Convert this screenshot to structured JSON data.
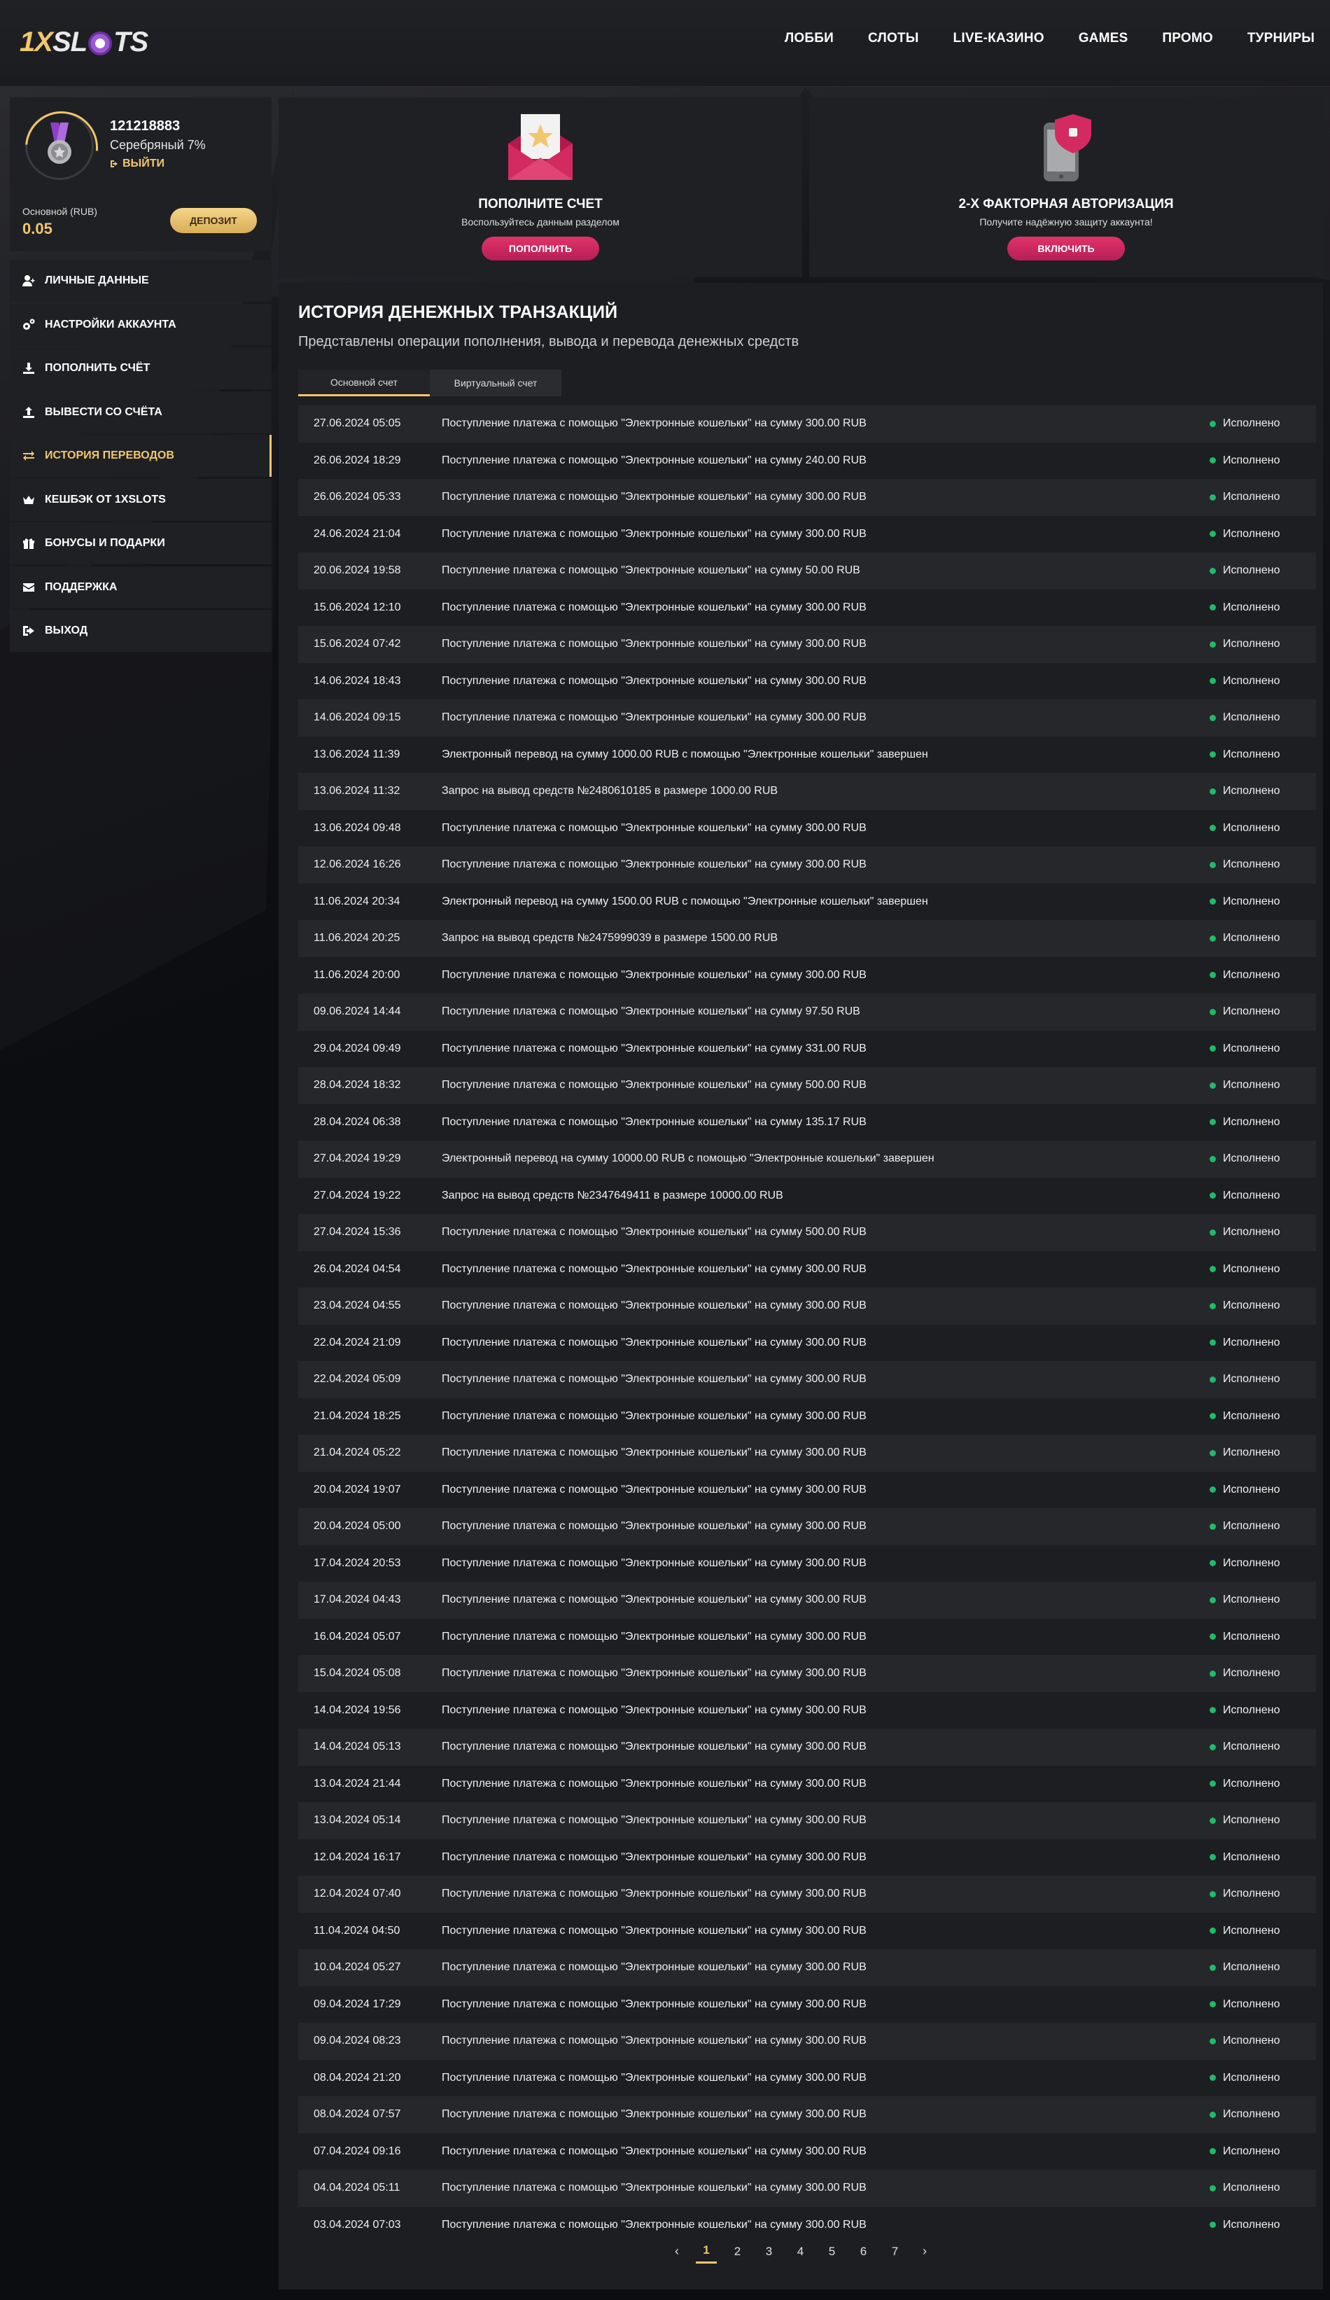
{
  "header": {
    "logo_part1": "1X",
    "logo_part2": "SL",
    "logo_part3": "TS",
    "nav": [
      "ЛОББИ",
      "СЛОТЫ",
      "LIVE-КАЗИНО",
      "GAMES",
      "ПРОМО",
      "ТУРНИРЫ"
    ]
  },
  "profile": {
    "user_id": "121218883",
    "level": "Серебряный 7%",
    "logout_link": "ВЫЙТИ",
    "balance_label": "Основной (RUB)",
    "balance_value": "0.05",
    "deposit_button": "ДЕПОЗИТ"
  },
  "menu": [
    {
      "label": "ЛИЧНЫЕ ДАННЫЕ",
      "icon": "user-plus-icon"
    },
    {
      "label": "НАСТРОЙКИ АККАУНТА",
      "icon": "gears-icon"
    },
    {
      "label": "ПОПОЛНИТЬ СЧЁТ",
      "icon": "download-icon"
    },
    {
      "label": "ВЫВЕСТИ СО СЧЁТА",
      "icon": "upload-icon"
    },
    {
      "label": "ИСТОРИЯ ПЕРЕВОДОВ",
      "icon": "exchange-icon",
      "active": true
    },
    {
      "label": "КЕШБЭК ОТ 1XSLOTS",
      "icon": "crown-icon"
    },
    {
      "label": "БОНУСЫ И ПОДАРКИ",
      "icon": "gift-icon"
    },
    {
      "label": "ПОДДЕРЖКА",
      "icon": "envelope-icon"
    },
    {
      "label": "ВЫХОД",
      "icon": "sign-out-icon"
    }
  ],
  "cards": {
    "deposit": {
      "title": "ПОПОЛНИТЕ СЧЕТ",
      "subtitle": "Воспользуйтесь данным разделом",
      "button": "ПОПОЛНИТЬ"
    },
    "twofa": {
      "title": "2-Х ФАКТОРНАЯ АВТОРИЗАЦИЯ",
      "subtitle": "Получите надёжную защиту аккаунта!",
      "button": "ВКЛЮЧИТЬ"
    }
  },
  "main": {
    "title": "ИСТОРИЯ ДЕНЕЖНЫХ ТРАНЗАКЦИЙ",
    "subtitle": "Представлены операции пополнения, вывода и перевода денежных средств",
    "tabs": [
      "Основной счет",
      "Виртуальный счет"
    ]
  },
  "colors": {
    "accent": "#f1c76d",
    "pink": "#d42a62",
    "status_ok": "#1fba6a"
  },
  "transactions": [
    {
      "date": "27.06.2024 05:05",
      "desc": "Поступление платежа с помощью \"Электронные кошельки\" на сумму 300.00 RUB",
      "status": "Исполнено"
    },
    {
      "date": "26.06.2024 18:29",
      "desc": "Поступление платежа с помощью \"Электронные кошельки\" на сумму 240.00 RUB",
      "status": "Исполнено"
    },
    {
      "date": "26.06.2024 05:33",
      "desc": "Поступление платежа с помощью \"Электронные кошельки\" на сумму 300.00 RUB",
      "status": "Исполнено"
    },
    {
      "date": "24.06.2024 21:04",
      "desc": "Поступление платежа с помощью \"Электронные кошельки\" на сумму 300.00 RUB",
      "status": "Исполнено"
    },
    {
      "date": "20.06.2024 19:58",
      "desc": "Поступление платежа с помощью \"Электронные кошельки\" на сумму 50.00 RUB",
      "status": "Исполнено"
    },
    {
      "date": "15.06.2024 12:10",
      "desc": "Поступление платежа с помощью \"Электронные кошельки\" на сумму 300.00 RUB",
      "status": "Исполнено"
    },
    {
      "date": "15.06.2024 07:42",
      "desc": "Поступление платежа с помощью \"Электронные кошельки\" на сумму 300.00 RUB",
      "status": "Исполнено"
    },
    {
      "date": "14.06.2024 18:43",
      "desc": "Поступление платежа с помощью \"Электронные кошельки\" на сумму 300.00 RUB",
      "status": "Исполнено"
    },
    {
      "date": "14.06.2024 09:15",
      "desc": "Поступление платежа с помощью \"Электронные кошельки\" на сумму 300.00 RUB",
      "status": "Исполнено"
    },
    {
      "date": "13.06.2024 11:39",
      "desc": "Электронный перевод на сумму 1000.00 RUB с помощью \"Электронные кошельки\" завершен",
      "status": "Исполнено"
    },
    {
      "date": "13.06.2024 11:32",
      "desc": "Запрос на вывод средств №2480610185 в размере 1000.00 RUB",
      "status": "Исполнено"
    },
    {
      "date": "13.06.2024 09:48",
      "desc": "Поступление платежа с помощью \"Электронные кошельки\" на сумму 300.00 RUB",
      "status": "Исполнено"
    },
    {
      "date": "12.06.2024 16:26",
      "desc": "Поступление платежа с помощью \"Электронные кошельки\" на сумму 300.00 RUB",
      "status": "Исполнено"
    },
    {
      "date": "11.06.2024 20:34",
      "desc": "Электронный перевод на сумму 1500.00 RUB с помощью \"Электронные кошельки\" завершен",
      "status": "Исполнено"
    },
    {
      "date": "11.06.2024 20:25",
      "desc": "Запрос на вывод средств №2475999039 в размере 1500.00 RUB",
      "status": "Исполнено"
    },
    {
      "date": "11.06.2024 20:00",
      "desc": "Поступление платежа с помощью \"Электронные кошельки\" на сумму 300.00 RUB",
      "status": "Исполнено"
    },
    {
      "date": "09.06.2024 14:44",
      "desc": "Поступление платежа с помощью \"Электронные кошельки\" на сумму 97.50 RUB",
      "status": "Исполнено"
    },
    {
      "date": "29.04.2024 09:49",
      "desc": "Поступление платежа с помощью \"Электронные кошельки\" на сумму 331.00 RUB",
      "status": "Исполнено"
    },
    {
      "date": "28.04.2024 18:32",
      "desc": "Поступление платежа с помощью \"Электронные кошельки\" на сумму 500.00 RUB",
      "status": "Исполнено"
    },
    {
      "date": "28.04.2024 06:38",
      "desc": "Поступление платежа с помощью \"Электронные кошельки\" на сумму 135.17 RUB",
      "status": "Исполнено"
    },
    {
      "date": "27.04.2024 19:29",
      "desc": "Электронный перевод на сумму 10000.00 RUB с помощью \"Электронные кошельки\" завершен",
      "status": "Исполнено"
    },
    {
      "date": "27.04.2024 19:22",
      "desc": "Запрос на вывод средств №2347649411 в размере 10000.00 RUB",
      "status": "Исполнено"
    },
    {
      "date": "27.04.2024 15:36",
      "desc": "Поступление платежа с помощью \"Электронные кошельки\" на сумму 500.00 RUB",
      "status": "Исполнено"
    },
    {
      "date": "26.04.2024 04:54",
      "desc": "Поступление платежа с помощью \"Электронные кошельки\" на сумму 300.00 RUB",
      "status": "Исполнено"
    },
    {
      "date": "23.04.2024 04:55",
      "desc": "Поступление платежа с помощью \"Электронные кошельки\" на сумму 300.00 RUB",
      "status": "Исполнено"
    },
    {
      "date": "22.04.2024 21:09",
      "desc": "Поступление платежа с помощью \"Электронные кошельки\" на сумму 300.00 RUB",
      "status": "Исполнено"
    },
    {
      "date": "22.04.2024 05:09",
      "desc": "Поступление платежа с помощью \"Электронные кошельки\" на сумму 300.00 RUB",
      "status": "Исполнено"
    },
    {
      "date": "21.04.2024 18:25",
      "desc": "Поступление платежа с помощью \"Электронные кошельки\" на сумму 300.00 RUB",
      "status": "Исполнено"
    },
    {
      "date": "21.04.2024 05:22",
      "desc": "Поступление платежа с помощью \"Электронные кошельки\" на сумму 300.00 RUB",
      "status": "Исполнено"
    },
    {
      "date": "20.04.2024 19:07",
      "desc": "Поступление платежа с помощью \"Электронные кошельки\" на сумму 300.00 RUB",
      "status": "Исполнено"
    },
    {
      "date": "20.04.2024 05:00",
      "desc": "Поступление платежа с помощью \"Электронные кошельки\" на сумму 300.00 RUB",
      "status": "Исполнено"
    },
    {
      "date": "17.04.2024 20:53",
      "desc": "Поступление платежа с помощью \"Электронные кошельки\" на сумму 300.00 RUB",
      "status": "Исполнено"
    },
    {
      "date": "17.04.2024 04:43",
      "desc": "Поступление платежа с помощью \"Электронные кошельки\" на сумму 300.00 RUB",
      "status": "Исполнено"
    },
    {
      "date": "16.04.2024 05:07",
      "desc": "Поступление платежа с помощью \"Электронные кошельки\" на сумму 300.00 RUB",
      "status": "Исполнено"
    },
    {
      "date": "15.04.2024 05:08",
      "desc": "Поступление платежа с помощью \"Электронные кошельки\" на сумму 300.00 RUB",
      "status": "Исполнено"
    },
    {
      "date": "14.04.2024 19:56",
      "desc": "Поступление платежа с помощью \"Электронные кошельки\" на сумму 300.00 RUB",
      "status": "Исполнено"
    },
    {
      "date": "14.04.2024 05:13",
      "desc": "Поступление платежа с помощью \"Электронные кошельки\" на сумму 300.00 RUB",
      "status": "Исполнено"
    },
    {
      "date": "13.04.2024 21:44",
      "desc": "Поступление платежа с помощью \"Электронные кошельки\" на сумму 300.00 RUB",
      "status": "Исполнено"
    },
    {
      "date": "13.04.2024 05:14",
      "desc": "Поступление платежа с помощью \"Электронные кошельки\" на сумму 300.00 RUB",
      "status": "Исполнено"
    },
    {
      "date": "12.04.2024 16:17",
      "desc": "Поступление платежа с помощью \"Электронные кошельки\" на сумму 300.00 RUB",
      "status": "Исполнено"
    },
    {
      "date": "12.04.2024 07:40",
      "desc": "Поступление платежа с помощью \"Электронные кошельки\" на сумму 300.00 RUB",
      "status": "Исполнено"
    },
    {
      "date": "11.04.2024 04:50",
      "desc": "Поступление платежа с помощью \"Электронные кошельки\" на сумму 300.00 RUB",
      "status": "Исполнено"
    },
    {
      "date": "10.04.2024 05:27",
      "desc": "Поступление платежа с помощью \"Электронные кошельки\" на сумму 300.00 RUB",
      "status": "Исполнено"
    },
    {
      "date": "09.04.2024 17:29",
      "desc": "Поступление платежа с помощью \"Электронные кошельки\" на сумму 300.00 RUB",
      "status": "Исполнено"
    },
    {
      "date": "09.04.2024 08:23",
      "desc": "Поступление платежа с помощью \"Электронные кошельки\" на сумму 300.00 RUB",
      "status": "Исполнено"
    },
    {
      "date": "08.04.2024 21:20",
      "desc": "Поступление платежа с помощью \"Электронные кошельки\" на сумму 300.00 RUB",
      "status": "Исполнено"
    },
    {
      "date": "08.04.2024 07:57",
      "desc": "Поступление платежа с помощью \"Электронные кошельки\" на сумму 300.00 RUB",
      "status": "Исполнено"
    },
    {
      "date": "07.04.2024 09:16",
      "desc": "Поступление платежа с помощью \"Электронные кошельки\" на сумму 300.00 RUB",
      "status": "Исполнено"
    },
    {
      "date": "04.04.2024 05:11",
      "desc": "Поступление платежа с помощью \"Электронные кошельки\" на сумму 300.00 RUB",
      "status": "Исполнено"
    },
    {
      "date": "03.04.2024 07:03",
      "desc": "Поступление платежа с помощью \"Электронные кошельки\" на сумму 300.00 RUB",
      "status": "Исполнено"
    }
  ],
  "pagination": {
    "prev": "‹",
    "next": "›",
    "pages": [
      "1",
      "2",
      "3",
      "4",
      "5",
      "6",
      "7"
    ],
    "current": "1"
  }
}
